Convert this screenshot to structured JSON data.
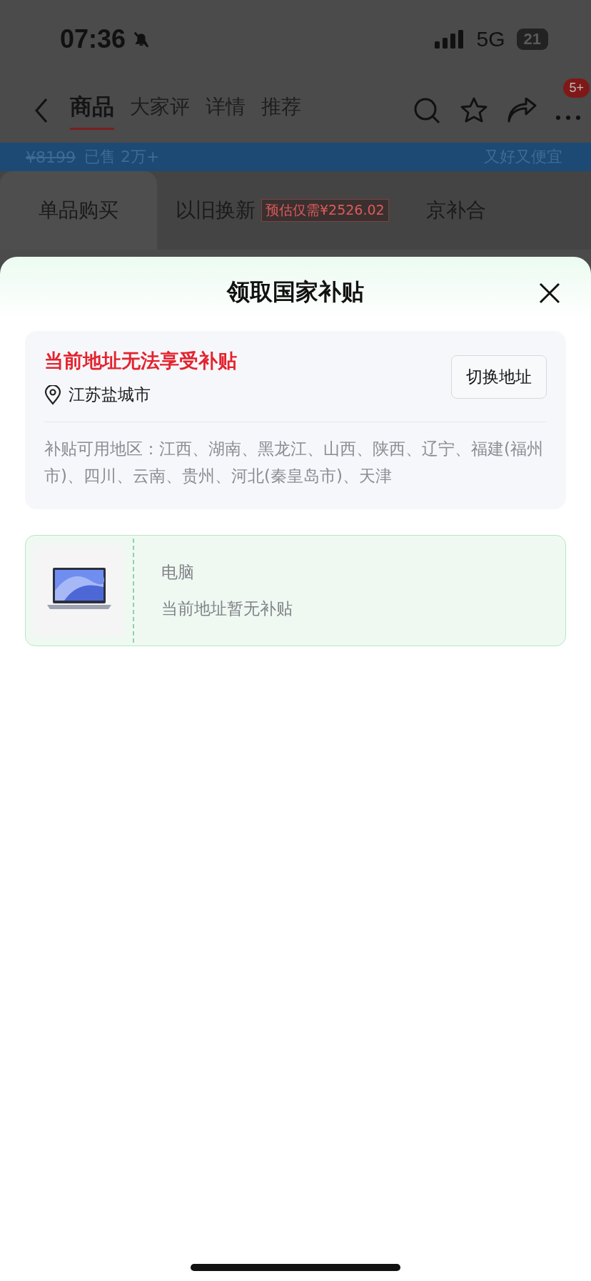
{
  "status_bar": {
    "time": "07:36",
    "network": "5G",
    "battery": "21"
  },
  "nav": {
    "tabs": [
      {
        "label": "商品",
        "selected": true
      },
      {
        "label": "大家评",
        "selected": false
      },
      {
        "label": "详情",
        "selected": false
      },
      {
        "label": "推荐",
        "selected": false
      }
    ],
    "badge": "5+"
  },
  "banner": {
    "price": "¥8199",
    "sold": "已售 2万+",
    "slogan": "又好又便宜"
  },
  "purchase_tabs": [
    {
      "label": "单品购买",
      "selected": true
    },
    {
      "label": "以旧换新",
      "selected": false,
      "tag": "预估仅需¥2526.02"
    },
    {
      "label": "京补合",
      "selected": false
    }
  ],
  "sheet": {
    "title": "领取国家补贴",
    "address_card": {
      "warning": "当前地址无法享受补贴",
      "location": "江苏盐城市",
      "button": "切换地址",
      "regions": "补贴可用地区：江西、湖南、黑龙江、山西、陕西、辽宁、福建(福州市)、四川、云南、贵州、河北(秦皇岛市)、天津"
    },
    "products": [
      {
        "category": "电脑",
        "status": "当前地址暂无补贴"
      }
    ]
  }
}
